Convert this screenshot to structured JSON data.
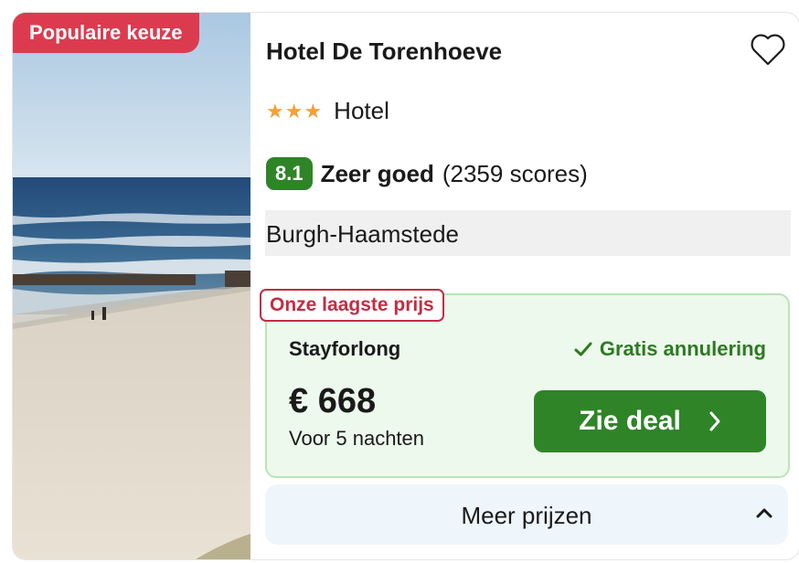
{
  "badge": "Populaire keuze",
  "hotel": {
    "name": "Hotel De Torenhoeve",
    "stars": "★★★",
    "star_count": 3,
    "type": "Hotel",
    "score": "8.1",
    "rating_label": "Zeer goed",
    "reviews": "(2359 scores)",
    "location": "Burgh-Haamstede"
  },
  "deal": {
    "tag": "Onze laagste prijs",
    "provider": "Stayforlong",
    "cancellation": "Gratis annulering",
    "price": "€ 668",
    "nights": "Voor 5 nachten",
    "button_label": "Zie deal"
  },
  "more_prices": "Meer prijzen",
  "icons": {
    "favorite": "heart-icon",
    "check": "check-icon",
    "deal_arrow": "chevron-right-icon",
    "collapse": "chevron-up-icon"
  },
  "colors": {
    "badge": "#dc3b4f",
    "score": "#2f8428",
    "stars": "#f2a13a",
    "deal_button": "#2f8428",
    "lowest_tag": "#c02e44",
    "cancel_text": "#2d7a23"
  }
}
